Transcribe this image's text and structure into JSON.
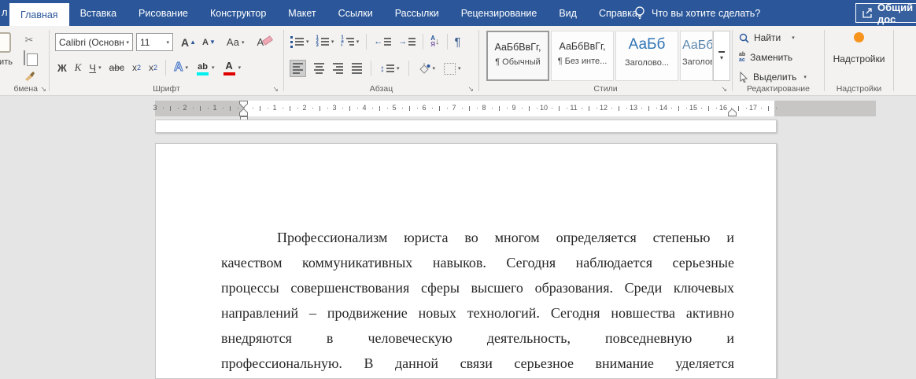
{
  "window": {
    "file_tab_fragment": "л",
    "assistant_prompt": "Что вы хотите сделать?",
    "share_button": "Общий дос"
  },
  "tabs": [
    {
      "label": "Главная",
      "active": true
    },
    {
      "label": "Вставка",
      "active": false
    },
    {
      "label": "Рисование",
      "active": false
    },
    {
      "label": "Конструктор",
      "active": false
    },
    {
      "label": "Макет",
      "active": false
    },
    {
      "label": "Ссылки",
      "active": false
    },
    {
      "label": "Рассылки",
      "active": false
    },
    {
      "label": "Рецензирование",
      "active": false
    },
    {
      "label": "Вид",
      "active": false
    },
    {
      "label": "Справка",
      "active": false
    }
  ],
  "ribbon": {
    "clipboard": {
      "paste_label_fragment": "зить",
      "group_label_fragment": "бмена"
    },
    "font": {
      "font_name": "Calibri (Основн",
      "font_size": "11",
      "grow_font": "А",
      "shrink_font": "А",
      "change_case": "Аа",
      "clear_format": "А",
      "bold": "Ж",
      "italic": "К",
      "underline": "Ч",
      "strikethrough": "abc",
      "subscript_base": "x",
      "subscript_mark": "2",
      "superscript_base": "x",
      "superscript_mark": "2",
      "text_effects": "А",
      "highlight": "ab",
      "font_color": "А",
      "group_label": "Шрифт"
    },
    "paragraph": {
      "sort_top": "А",
      "sort_bottom": "Я",
      "pilcrow": "¶",
      "group_label": "Абзац"
    },
    "styles": {
      "group_label": "Стили",
      "items": [
        {
          "sample": "АаБбВвГг,",
          "name": "¶ Обычный"
        },
        {
          "sample": "АаБбВвГг,",
          "name": "¶ Без инте..."
        },
        {
          "sample": "АаБб",
          "name": "Заголово..."
        },
        {
          "sample": "АаБбВ",
          "name": "Заголово..."
        }
      ]
    },
    "editing": {
      "find": "Найти",
      "replace": "Заменить",
      "select": "Выделить",
      "replace_icon_top": "ab",
      "replace_icon_bottom": "ac",
      "group_label": "Редактирование"
    },
    "addins": {
      "button_label": "Надстройки",
      "group_label": "Надстройки"
    }
  },
  "ruler": {
    "left_numbers": [
      "3",
      "2",
      "1"
    ],
    "main_numbers": [
      "1",
      "2",
      "3",
      "4",
      "5",
      "6",
      "7",
      "8",
      "9",
      "10",
      "11",
      "12",
      "13",
      "14",
      "15",
      "16",
      "17"
    ]
  },
  "document": {
    "lines": [
      "Профессионализм юриста во многом определяется степенью и",
      "качеством коммуникативных навыков. Сегодня наблюдается серьезные",
      "процессы совершенствования сферы высшего образования. Среди ключевых",
      "направлений – продвижение новых технологий. Сегодня новшества активно",
      "внедряются в человеческую деятельность, повседневную и",
      "профессиональную. В данной связи серьезное внимание уделяется"
    ]
  },
  "colors": {
    "accent": "#2b579a",
    "highlight_cyan": "#00f0f0",
    "font_color_red": "#e00000",
    "addin_orange": "#f7941d",
    "heading1_blue": "#2e74b5",
    "heading2_blue": "#5b87ad"
  }
}
